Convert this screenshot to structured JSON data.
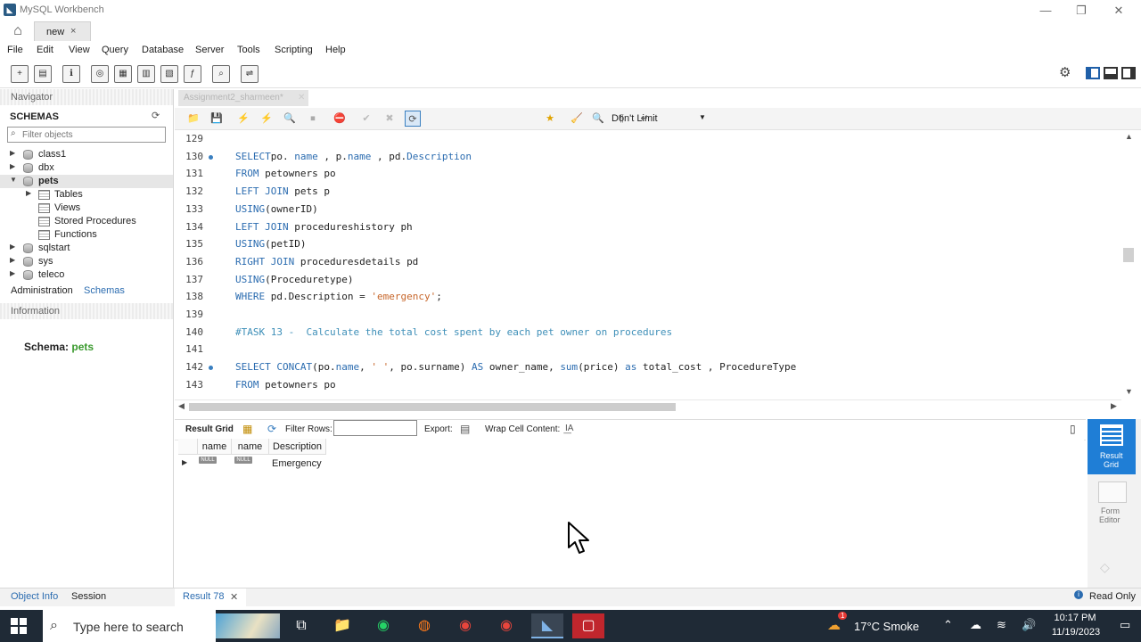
{
  "window": {
    "title": "MySQL Workbench",
    "app_icon": "mysql-workbench-icon"
  },
  "connection_tabs": [
    {
      "label": "new",
      "close": "×"
    }
  ],
  "menu": [
    "File",
    "Edit",
    "View",
    "Query",
    "Database",
    "Server",
    "Tools",
    "Scripting",
    "Help"
  ],
  "navigator": {
    "title": "Navigator",
    "schemas_label": "SCHEMAS",
    "filter_placeholder": "Filter objects",
    "schemas": [
      {
        "name": "class1"
      },
      {
        "name": "dbx"
      },
      {
        "name": "pets",
        "expanded": true,
        "children": [
          "Tables",
          "Views",
          "Stored Procedures",
          "Functions"
        ]
      },
      {
        "name": "sqlstart"
      },
      {
        "name": "sys"
      },
      {
        "name": "teleco"
      }
    ],
    "tabs": [
      "Administration",
      "Schemas"
    ],
    "information_label": "Information",
    "schema_info_label": "Schema:",
    "schema_info_value": "pets"
  },
  "editor": {
    "tab_label": "Assignment2_sharmeen*",
    "limit_select": "Don't Limit",
    "lines": [
      {
        "n": "129",
        "dot": false,
        "segs": []
      },
      {
        "n": "130",
        "dot": true,
        "segs": [
          [
            "kw",
            "SELECT"
          ],
          [
            "",
            "po. "
          ],
          [
            "kw",
            "name"
          ],
          [
            "",
            " , p."
          ],
          [
            "kw",
            "name"
          ],
          [
            "",
            " , pd."
          ],
          [
            "kw",
            "Description"
          ]
        ]
      },
      {
        "n": "131",
        "dot": false,
        "segs": [
          [
            "kw",
            "FROM"
          ],
          [
            "",
            " petowners po"
          ]
        ]
      },
      {
        "n": "132",
        "dot": false,
        "segs": [
          [
            "kw",
            "LEFT JOIN"
          ],
          [
            "",
            " pets p"
          ]
        ]
      },
      {
        "n": "133",
        "dot": false,
        "segs": [
          [
            "kw",
            "USING"
          ],
          [
            "",
            "(ownerID)"
          ]
        ]
      },
      {
        "n": "134",
        "dot": false,
        "segs": [
          [
            "kw",
            "LEFT JOIN"
          ],
          [
            "",
            " procedureshistory ph"
          ]
        ]
      },
      {
        "n": "135",
        "dot": false,
        "segs": [
          [
            "kw",
            "USING"
          ],
          [
            "",
            "(petID)"
          ]
        ]
      },
      {
        "n": "136",
        "dot": false,
        "segs": [
          [
            "kw",
            "RIGHT JOIN"
          ],
          [
            "",
            " proceduresdetails pd"
          ]
        ]
      },
      {
        "n": "137",
        "dot": false,
        "segs": [
          [
            "kw",
            "USING"
          ],
          [
            "",
            "(Proceduretype)"
          ]
        ]
      },
      {
        "n": "138",
        "dot": false,
        "segs": [
          [
            "kw",
            "WHERE"
          ],
          [
            "",
            " pd.Description = "
          ],
          [
            "str",
            "'emergency'"
          ],
          [
            "",
            ";"
          ]
        ]
      },
      {
        "n": "139",
        "dot": false,
        "segs": []
      },
      {
        "n": "140",
        "dot": false,
        "segs": [
          [
            "cmt",
            "#TASK 13 -  Calculate the total cost spent by each pet owner on procedures"
          ]
        ]
      },
      {
        "n": "141",
        "dot": false,
        "segs": []
      },
      {
        "n": "142",
        "dot": true,
        "segs": [
          [
            "kw",
            "SELECT"
          ],
          [
            "",
            " "
          ],
          [
            "kw",
            "CONCAT"
          ],
          [
            "",
            "(po."
          ],
          [
            "kw",
            "name"
          ],
          [
            "",
            ", "
          ],
          [
            "str",
            "' '"
          ],
          [
            "",
            ", po.surname) "
          ],
          [
            "kw",
            "AS"
          ],
          [
            "",
            " owner_name, "
          ],
          [
            "kw",
            "sum"
          ],
          [
            "",
            "(price) "
          ],
          [
            "kw",
            "as"
          ],
          [
            "",
            " total_cost , ProcedureType"
          ]
        ]
      },
      {
        "n": "143",
        "dot": false,
        "segs": [
          [
            "kw",
            "FROM"
          ],
          [
            "",
            " petowners po"
          ]
        ]
      }
    ]
  },
  "result": {
    "grid_label": "Result Grid",
    "filter_label": "Filter Rows:",
    "export_label": "Export:",
    "wrap_label": "Wrap Cell Content:",
    "columns": [
      "name",
      "name",
      "Description"
    ],
    "rows": [
      [
        "NULL",
        "NULL",
        "Emergency"
      ]
    ],
    "side_tabs": [
      {
        "label1": "Result",
        "label2": "Grid"
      },
      {
        "label1": "Form",
        "label2": "Editor"
      }
    ]
  },
  "bottom": {
    "left_tabs": [
      "Object Info",
      "Session"
    ],
    "result_tab": "Result 78",
    "status": "Read Only"
  },
  "taskbar": {
    "search_placeholder": "Type here to search",
    "weather": "17°C  Smoke",
    "time": "10:17 PM",
    "date": "11/19/2023",
    "notification_count": "1"
  }
}
